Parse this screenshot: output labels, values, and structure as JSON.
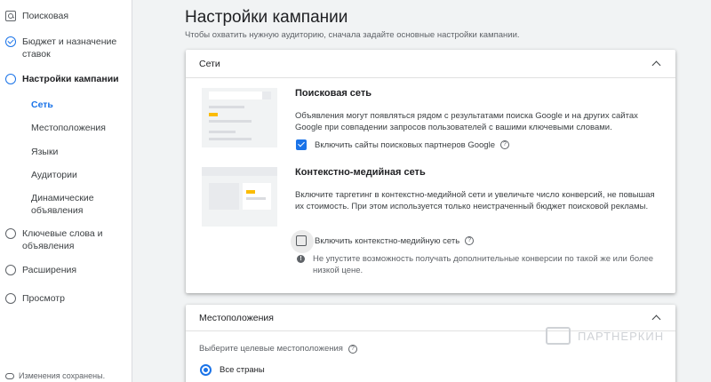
{
  "sidebar": {
    "items": [
      {
        "label": "Поисковая",
        "icon": "search-box-icon"
      },
      {
        "label": "Бюджет и назначение ставок",
        "icon": "check-circle-icon"
      },
      {
        "label": "Настройки кампании",
        "icon": "circle-icon"
      },
      {
        "label": "Ключевые слова и объявления",
        "icon": "circle-icon"
      },
      {
        "label": "Расширения",
        "icon": "circle-icon"
      },
      {
        "label": "Просмотр",
        "icon": "circle-icon"
      }
    ],
    "subitems": [
      "Сеть",
      "Местоположения",
      "Языки",
      "Аудитории",
      "Динамические объявления"
    ],
    "saved": "Изменения сохранены."
  },
  "page": {
    "title": "Настройки кампании",
    "subtitle": "Чтобы охватить нужную аудиторию, сначала задайте основные настройки кампании."
  },
  "networks": {
    "header": "Сети",
    "search": {
      "title": "Поисковая сеть",
      "description": "Объявления могут появляться рядом с результатами поиска Google и на других сайтах Google при совпадении запросов пользователей с вашими ключевыми словами.",
      "checkbox_label": "Включить сайты поисковых партнеров Google",
      "checked": true
    },
    "display": {
      "title": "Контекстно-медийная сеть",
      "description": "Включите таргетинг в контекстно-медийной сети и увеличьте число конверсий, не повышая их стоимость. При этом используется только неистраченный бюджет поисковой рекламы.",
      "checkbox_label": "Включить контекстно-медийную сеть",
      "checked": false,
      "info": "Не упустите возможность получать дополнительные конверсии по такой же или более низкой цене."
    }
  },
  "locations": {
    "header": "Местоположения",
    "label": "Выберите целевые местоположения",
    "selected_option": "Все страны"
  },
  "watermark": "ПАРТНЕРКИН",
  "colors": {
    "accent": "#1a73e8",
    "highlight": "#fbbc04"
  }
}
